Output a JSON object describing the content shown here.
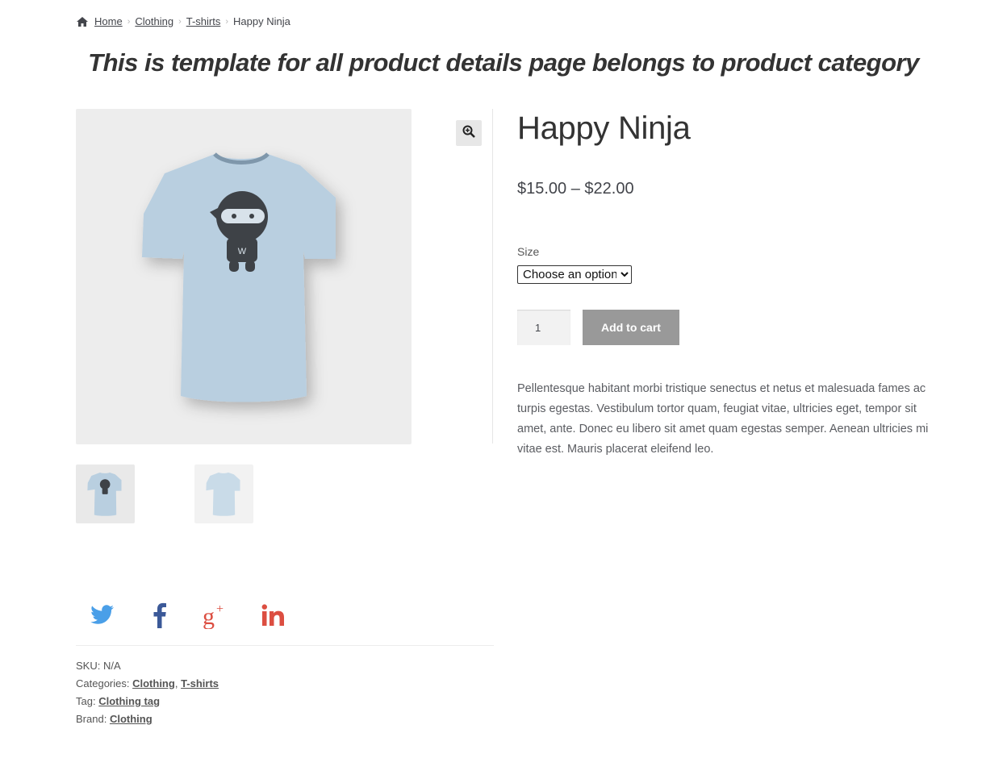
{
  "breadcrumb": {
    "home": "Home",
    "items": [
      "Clothing",
      "T-shirts"
    ],
    "current": "Happy Ninja"
  },
  "heading": "This is template for all product details page belongs to product category",
  "product": {
    "title": "Happy Ninja",
    "price": "$15.00 – $22.00",
    "size_label": "Size",
    "size_selected": "Choose an option",
    "quantity": "1",
    "add_to_cart": "Add to cart",
    "description": "Pellentesque habitant morbi tristique senectus et netus et malesuada fames ac turpis egestas. Vestibulum tortor quam, feugiat vitae, ultricies eget, tempor sit amet, ante. Donec eu libero sit amet quam egestas semper. Aenean ultricies mi vitae est. Mauris placerat eleifend leo."
  },
  "share": {
    "icons": [
      "twitter-icon",
      "facebook-icon",
      "google-plus-icon",
      "linkedin-icon"
    ],
    "colors": {
      "twitter": "#4a9fe8",
      "facebook": "#3b5998",
      "google_plus": "#dc4e41",
      "linkedin": "#dc4e41"
    }
  },
  "meta": {
    "sku_label": "SKU:",
    "sku_value": "N/A",
    "categories_label": "Categories:",
    "category_1": "Clothing",
    "category_sep": ",",
    "category_2": "T-shirts",
    "tag_label": "Tag:",
    "tag_value": "Clothing tag",
    "brand_label": "Brand:",
    "brand_value": "Clothing"
  },
  "colors": {
    "shirt": "#b9cfe0",
    "button": "#999999"
  }
}
